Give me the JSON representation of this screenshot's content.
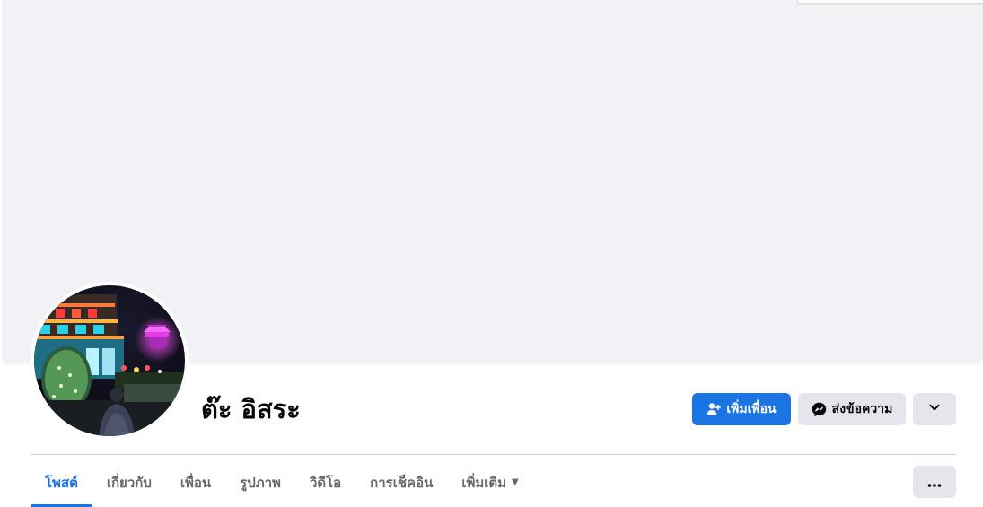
{
  "profile": {
    "name": "ต๊ะ อิสระ"
  },
  "actions": {
    "add_friend_label": "เพิ่มเพื่อน",
    "message_label": "ส่งข้อความ"
  },
  "tabs": [
    {
      "label": "โพสต์",
      "active": true
    },
    {
      "label": "เกี่ยวกับ",
      "active": false
    },
    {
      "label": "เพื่อน",
      "active": false
    },
    {
      "label": "รูปภาพ",
      "active": false
    },
    {
      "label": "วิดีโอ",
      "active": false
    },
    {
      "label": "การเช็คอิน",
      "active": false
    },
    {
      "label": "เพิ่มเติม",
      "active": false
    }
  ],
  "icons": {
    "add_friend": "add-friend-icon",
    "messenger": "messenger-icon",
    "chevron": "chevron-down-icon",
    "more": "more-options-icon"
  },
  "colors": {
    "accent": "#1b74e4",
    "cover_bg": "#f0f2f5",
    "secondary_button": "#e4e6eb",
    "tab_inactive": "#65676b"
  }
}
